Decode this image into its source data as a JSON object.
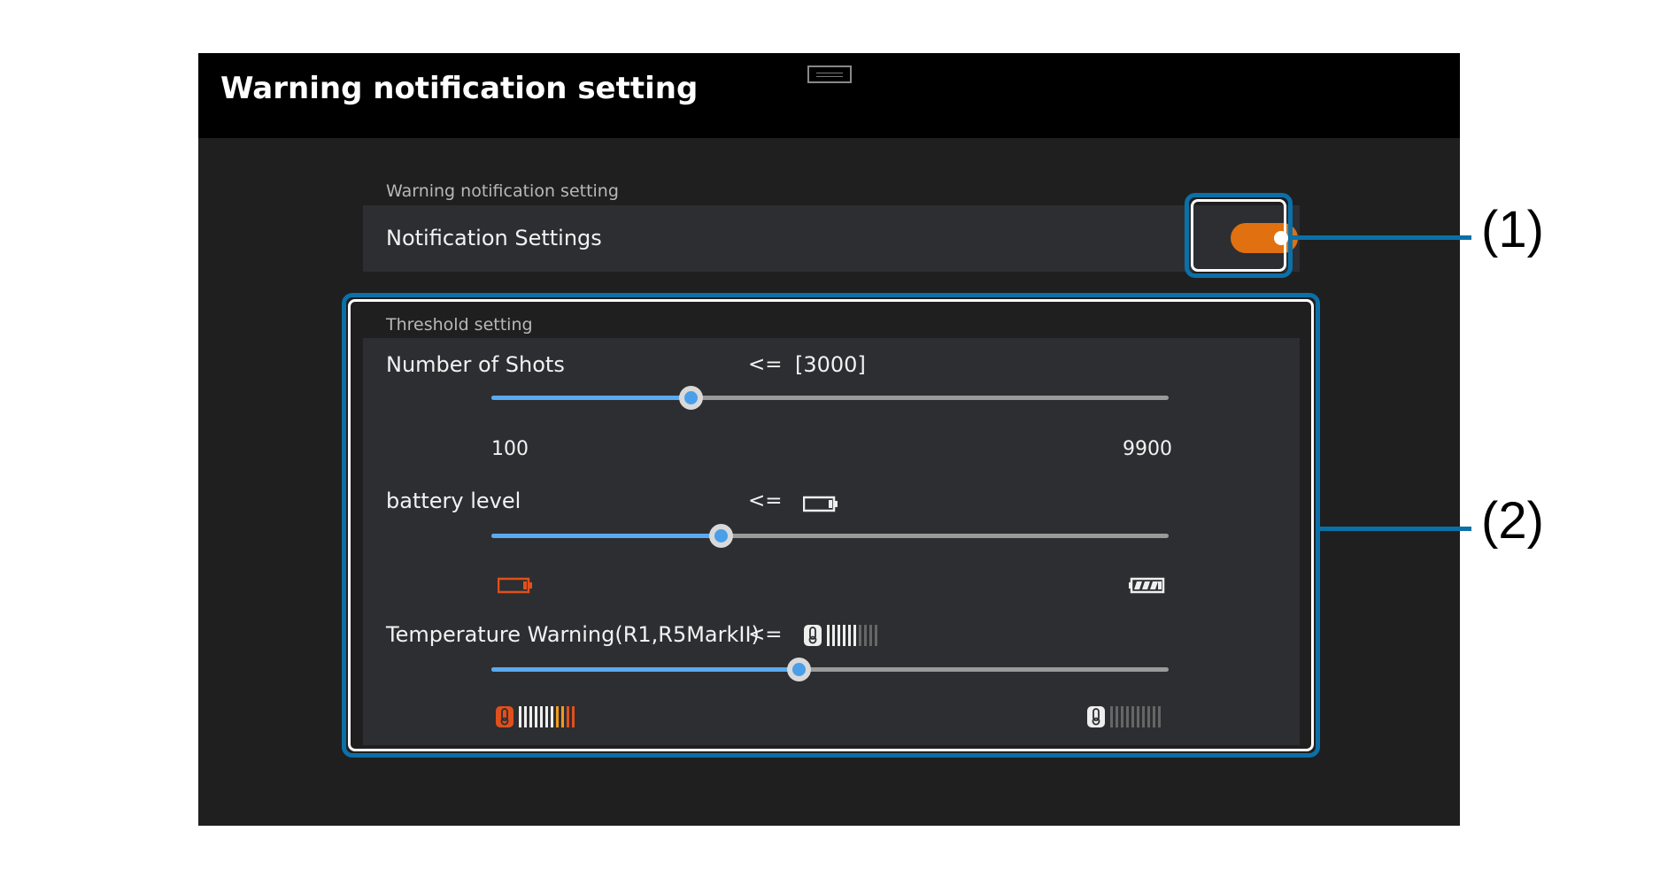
{
  "window": {
    "title": "Warning notification setting"
  },
  "notification": {
    "section_label": "Warning notification setting",
    "row_label": "Notification Settings",
    "toggle_on": true,
    "toggle_color": "#e07010"
  },
  "threshold": {
    "section_label": "Threshold setting",
    "shots": {
      "label": "Number of Shots",
      "operator": "<=",
      "value": "[3000]",
      "min_label": "100",
      "max_label": "9900",
      "min": 100,
      "max": 9900,
      "current": 3000
    },
    "battery": {
      "label": "battery level",
      "operator": "<=",
      "value_icon": "battery-low-icon",
      "min_icon": "battery-empty-red-icon",
      "max_icon": "battery-full-icon",
      "level_fraction": 0.34
    },
    "temperature": {
      "label": "Temperature Warning(R1,R5MarkII)",
      "operator": "<=",
      "value_icon": "thermometer-level-icon",
      "min_icon": "thermometer-hot-icon",
      "max_icon": "thermometer-cool-icon",
      "level_fraction": 0.455
    }
  },
  "callouts": {
    "one": "(1)",
    "two": "(2)"
  },
  "colors": {
    "accent_blue": "#4a9fe8",
    "warning_orange": "#e07010",
    "callout_blue": "#0b70a8"
  }
}
